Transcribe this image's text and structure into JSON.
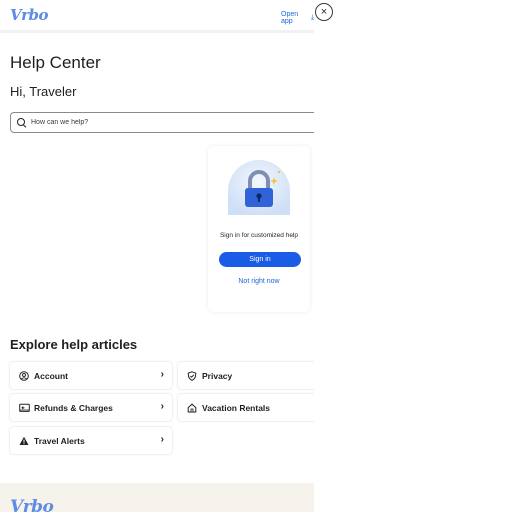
{
  "header": {
    "logo_text": "Vrbo",
    "open_app_label": "Open app",
    "close_label": "×"
  },
  "page": {
    "title": "Help Center",
    "greeting": "Hi, Traveler"
  },
  "search": {
    "placeholder": "How can we help?"
  },
  "signin_card": {
    "message": "Sign in for customized help",
    "signin_button": "Sign in",
    "not_now_link": "Not right now",
    "illustration_icon": "lock-icon"
  },
  "explore": {
    "title": "Explore help articles",
    "tiles": [
      {
        "label": "Account",
        "icon": "account-icon"
      },
      {
        "label": "Privacy",
        "icon": "privacy-shield-icon"
      },
      {
        "label": "Refunds & Charges",
        "icon": "refund-icon"
      },
      {
        "label": "Vacation Rentals",
        "icon": "home-icon"
      },
      {
        "label": "Travel Alerts",
        "icon": "alert-icon"
      }
    ]
  },
  "footer": {
    "logo_text": "Vrbo"
  },
  "colors": {
    "brand": "#5d8be6",
    "primary_button": "#1a5ce6",
    "link": "#1e63d8",
    "footer_bg": "#f6f3ec"
  }
}
